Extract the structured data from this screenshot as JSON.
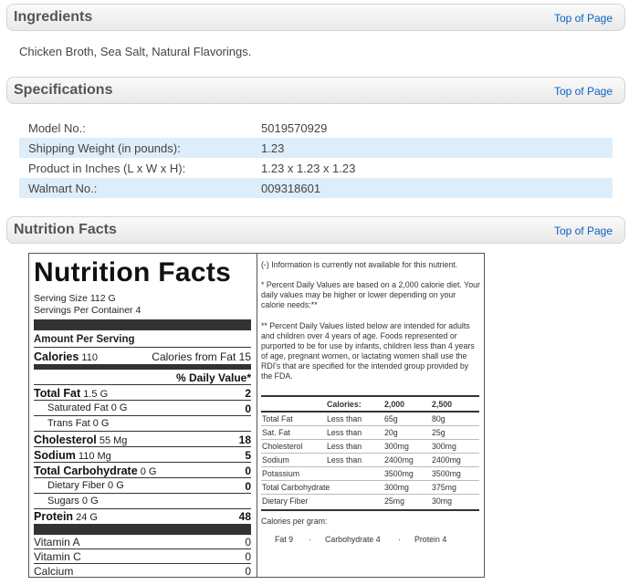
{
  "ingredients": {
    "title": "Ingredients",
    "top_link": "Top of Page",
    "text": "Chicken Broth, Sea Salt, Natural Flavorings."
  },
  "specifications": {
    "title": "Specifications",
    "top_link": "Top of Page",
    "rows": [
      {
        "label": "Model No.:",
        "value": "5019570929"
      },
      {
        "label": "Shipping Weight (in pounds):",
        "value": "1.23"
      },
      {
        "label": "Product in Inches (L x W x H):",
        "value": "1.23 x 1.23 x 1.23"
      },
      {
        "label": "Walmart No.:",
        "value": "009318601"
      }
    ]
  },
  "nutrition": {
    "title": "Nutrition Facts",
    "top_link": "Top of Page",
    "label_title": "Nutrition Facts",
    "serving_size": "Serving Size 112 G",
    "servings_per_container": "Servings Per Container 4",
    "amount_per_serving": "Amount Per Serving",
    "calories_label": "Calories",
    "calories_value": "110",
    "calories_from_fat": "Calories from Fat 15",
    "daily_value_header": "% Daily Value*",
    "nutrients": [
      {
        "name": "Total Fat",
        "amount": "1.5 G",
        "pct": "2"
      },
      {
        "name": "Saturated Fat",
        "amount": "0 G",
        "pct": "0"
      },
      {
        "name": "Trans Fat",
        "amount": "0 G",
        "pct": ""
      },
      {
        "name": "Cholesterol",
        "amount": "55 Mg",
        "pct": "18"
      },
      {
        "name": "Sodium",
        "amount": "110 Mg",
        "pct": "5"
      },
      {
        "name": "Total Carbohydrate",
        "amount": "0 G",
        "pct": "0"
      },
      {
        "name": "Dietary Fiber",
        "amount": "0 G",
        "pct": "0"
      },
      {
        "name": "Sugars",
        "amount": "0 G",
        "pct": ""
      },
      {
        "name": "Protein",
        "amount": "24 G",
        "pct": "48"
      }
    ],
    "vitamins": [
      {
        "name": "Vitamin A",
        "value": "0"
      },
      {
        "name": "Vitamin C",
        "value": "0"
      },
      {
        "name": "Calcium",
        "value": "0"
      }
    ],
    "notes": {
      "info_unavailable": "(-) Information is currently not available for this nutrient.",
      "percent_dv": "* Percent Daily Values are based on a 2,000 calorie diet. Your daily values may be higher or lower depending on your calorie needs:**",
      "percent_dv_children": "** Percent Daily Values listed below are intended for adults and children over 4 years of age. Foods represented or purported to be for use by infants, children less than 4 years of age, pregnant women, or lactating women shall use the RDI's that are specified for the intended group provided by the FDA."
    },
    "dv_table": {
      "headers": [
        "",
        "Calories:",
        "2,000",
        "2,500"
      ],
      "rows": [
        [
          "Total Fat",
          "Less than",
          "65g",
          "80g"
        ],
        [
          "Sat. Fat",
          "Less than",
          "20g",
          "25g"
        ],
        [
          "Cholesterol",
          "Less than",
          "300mg",
          "300mg"
        ],
        [
          "Sodium",
          "Less than",
          "2400mg",
          "2400mg"
        ],
        [
          "Potassium",
          "",
          "3500mg",
          "3500mg"
        ],
        [
          "Total Carbohydrate",
          "",
          "300mg",
          "375mg"
        ],
        [
          "Dietary Fiber",
          "",
          "25mg",
          "30mg"
        ]
      ]
    },
    "calories_per_gram": {
      "label": "Calories per gram:",
      "fat": "Fat 9",
      "carb": "Carbohydrate 4",
      "protein": "Protein 4",
      "separator": "·"
    }
  }
}
